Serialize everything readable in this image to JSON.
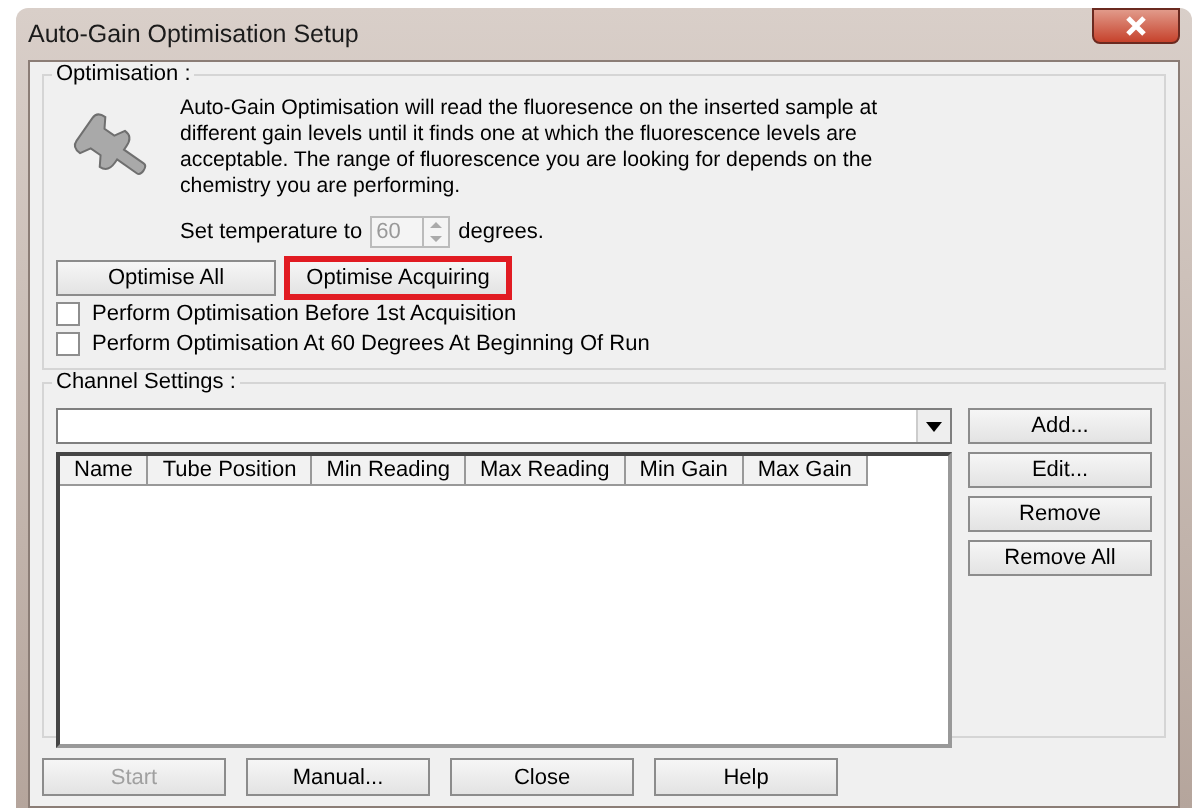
{
  "window": {
    "title": "Auto-Gain Optimisation Setup"
  },
  "optimisation": {
    "legend": "Optimisation :",
    "description": "Auto-Gain Optimisation will read the fluoresence on the inserted sample at different gain levels until it finds one at which the fluorescence levels are acceptable. The range of fluorescence you are looking for depends on the chemistry you are performing.",
    "temperature_label": "Set temperature to",
    "temperature": "60",
    "temperature_disabled": true,
    "temperature_unit": "degrees.",
    "buttons": [
      {
        "label": "Optimise All",
        "highlighted": false
      },
      {
        "label": "Optimise Acquiring",
        "highlighted": true
      }
    ],
    "options": [
      {
        "label": "Perform Optimisation Before 1st Acquisition",
        "checked": false
      },
      {
        "label": "Perform Optimisation At 60 Degrees At Beginning Of Run",
        "checked": false
      }
    ]
  },
  "channel_settings": {
    "legend": "Channel Settings :",
    "columns": [
      "Name",
      "Tube Position",
      "Min Reading",
      "Max Reading",
      "Min Gain",
      "Max Gain"
    ],
    "buttons": [
      {
        "label": "Add..."
      },
      {
        "label": "Edit..."
      },
      {
        "label": "Remove"
      },
      {
        "label": "Remove All"
      }
    ]
  },
  "footer_buttons": [
    {
      "label": "Start",
      "disabled": true
    },
    {
      "label": "Manual...",
      "disabled": false
    },
    {
      "label": "Close",
      "disabled": false
    },
    {
      "label": "Help",
      "disabled": false
    }
  ]
}
